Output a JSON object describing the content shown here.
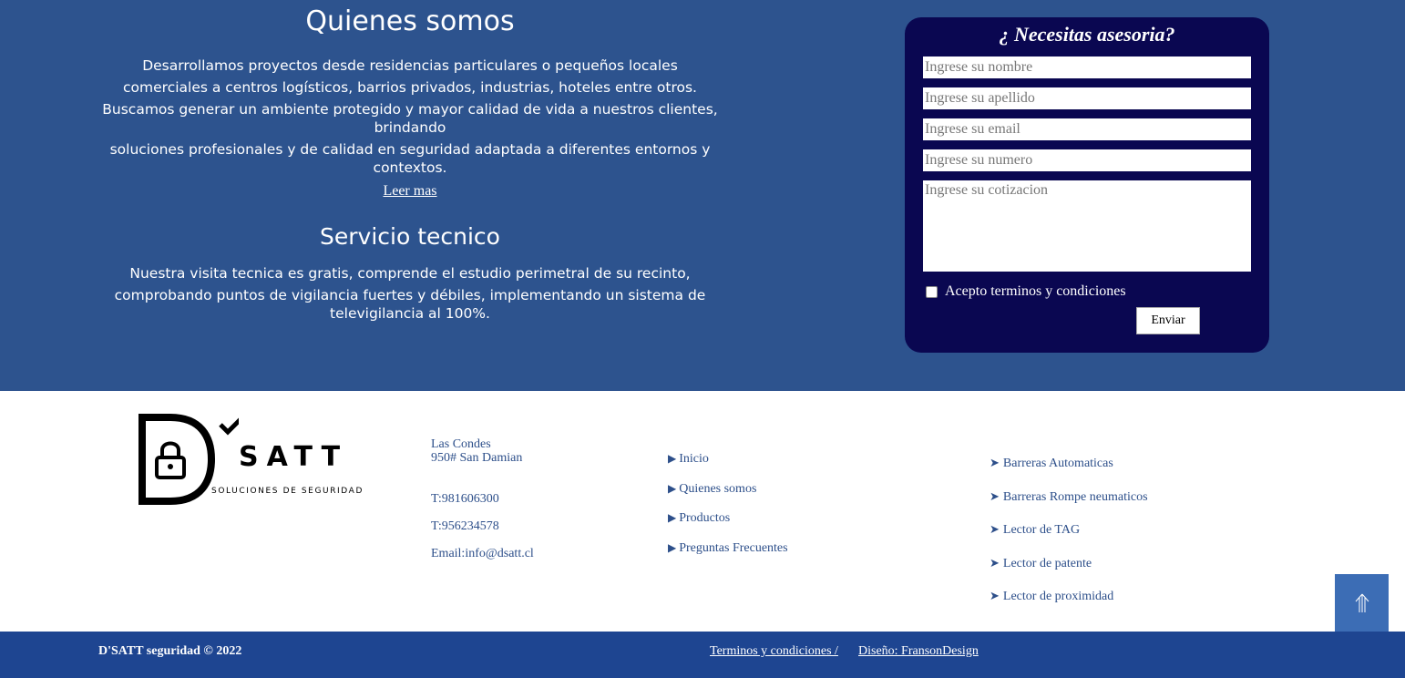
{
  "about": {
    "title": "Quienes somos",
    "paragraph_lines": [
      "Desarrollamos proyectos desde residencias particulares o pequeños locales",
      "comerciales a centros logísticos, barrios privados, industrias, hoteles entre otros.",
      "Buscamos generar un ambiente protegido y mayor calidad de vida a nuestros clientes, brindando",
      "soluciones profesionales y de calidad en seguridad adaptada a diferentes entornos y contextos."
    ],
    "read_more": "Leer mas"
  },
  "service": {
    "title": "Servicio tecnico",
    "paragraph_lines": [
      "Nuestra visita tecnica es gratis, comprende el estudio perimetral de su recinto,",
      "comprobando puntos de vigilancia fuertes y débiles, implementando un sistema de televigilancia al 100%."
    ]
  },
  "form": {
    "title": "¿ Necesitas asesoria?",
    "name_placeholder": "Ingrese su nombre",
    "lastname_placeholder": "Ingrese su apellido",
    "email_placeholder": "Ingrese su email",
    "number_placeholder": "Ingrese su numero",
    "quote_placeholder": "Ingrese su cotizacion",
    "terms_label": "Acepto terminos y condiciones",
    "send_label": "Enviar"
  },
  "logo": {
    "brand": "SATT",
    "tagline": "SOLUCIONES DE SEGURIDAD"
  },
  "contact": {
    "city": "Las Condes",
    "address": "950# San Damian",
    "phone1": "T:981606300",
    "phone2": "T:956234578",
    "email": "Email:info@dsatt.cl"
  },
  "nav_links": [
    "Inicio",
    "Quienes somos",
    "Productos",
    "Preguntas Frecuentes"
  ],
  "product_links": [
    "Barreras Automaticas",
    "Barreras Rompe neumaticos",
    "Lector de TAG",
    "Lector de patente",
    "Lector de proximidad"
  ],
  "footer": {
    "copyright": "D'SATT seguridad © 2022",
    "terms": "Terminos y condiciones /",
    "design": "Diseño: FransonDesign"
  },
  "colors": {
    "section_bg": "#2d538e",
    "form_bg": "#0a0751",
    "bottom_bar": "#1e4591",
    "link": "#2d4f8a"
  }
}
